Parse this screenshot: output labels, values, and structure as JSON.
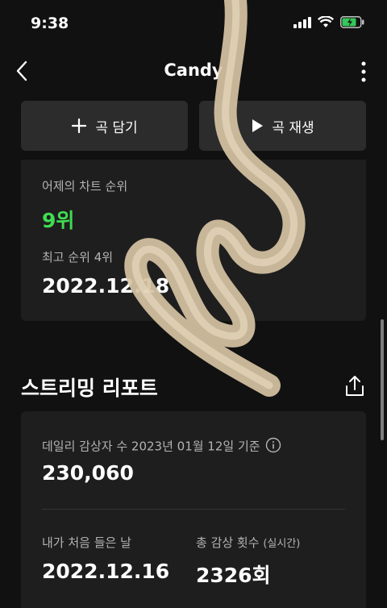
{
  "status_bar": {
    "time": "9:38"
  },
  "header": {
    "title": "Candy"
  },
  "actions": {
    "add_label": "곡 담기",
    "play_label": "곡 재생"
  },
  "chart_rank": {
    "yesterday_label": "어제의 차트 순위",
    "yesterday_rank": "9위",
    "best_label": "최고 순위 4위",
    "best_date": "2022.12.18"
  },
  "streaming_report": {
    "title": "스트리밍 리포트",
    "daily_label": "데일리 감상자 수 2023년 01월 12일 기준",
    "daily_value": "230,060",
    "first_listen_label": "내가 처음 들은 날",
    "first_listen_date": "2022.12.16",
    "total_plays_label": "총 감상 횟수",
    "total_plays_suffix": "(실시간)",
    "total_plays_value": "2326회"
  },
  "colors": {
    "accent_green": "#3fdc52",
    "background": "#111111",
    "card": "#1e1e1e",
    "button": "#2c2c2c"
  },
  "icons": [
    "back-chevron-icon",
    "more-vertical-icon",
    "plus-icon",
    "play-icon",
    "share-icon",
    "info-icon",
    "signal-icon",
    "wifi-icon",
    "battery-icon"
  ]
}
